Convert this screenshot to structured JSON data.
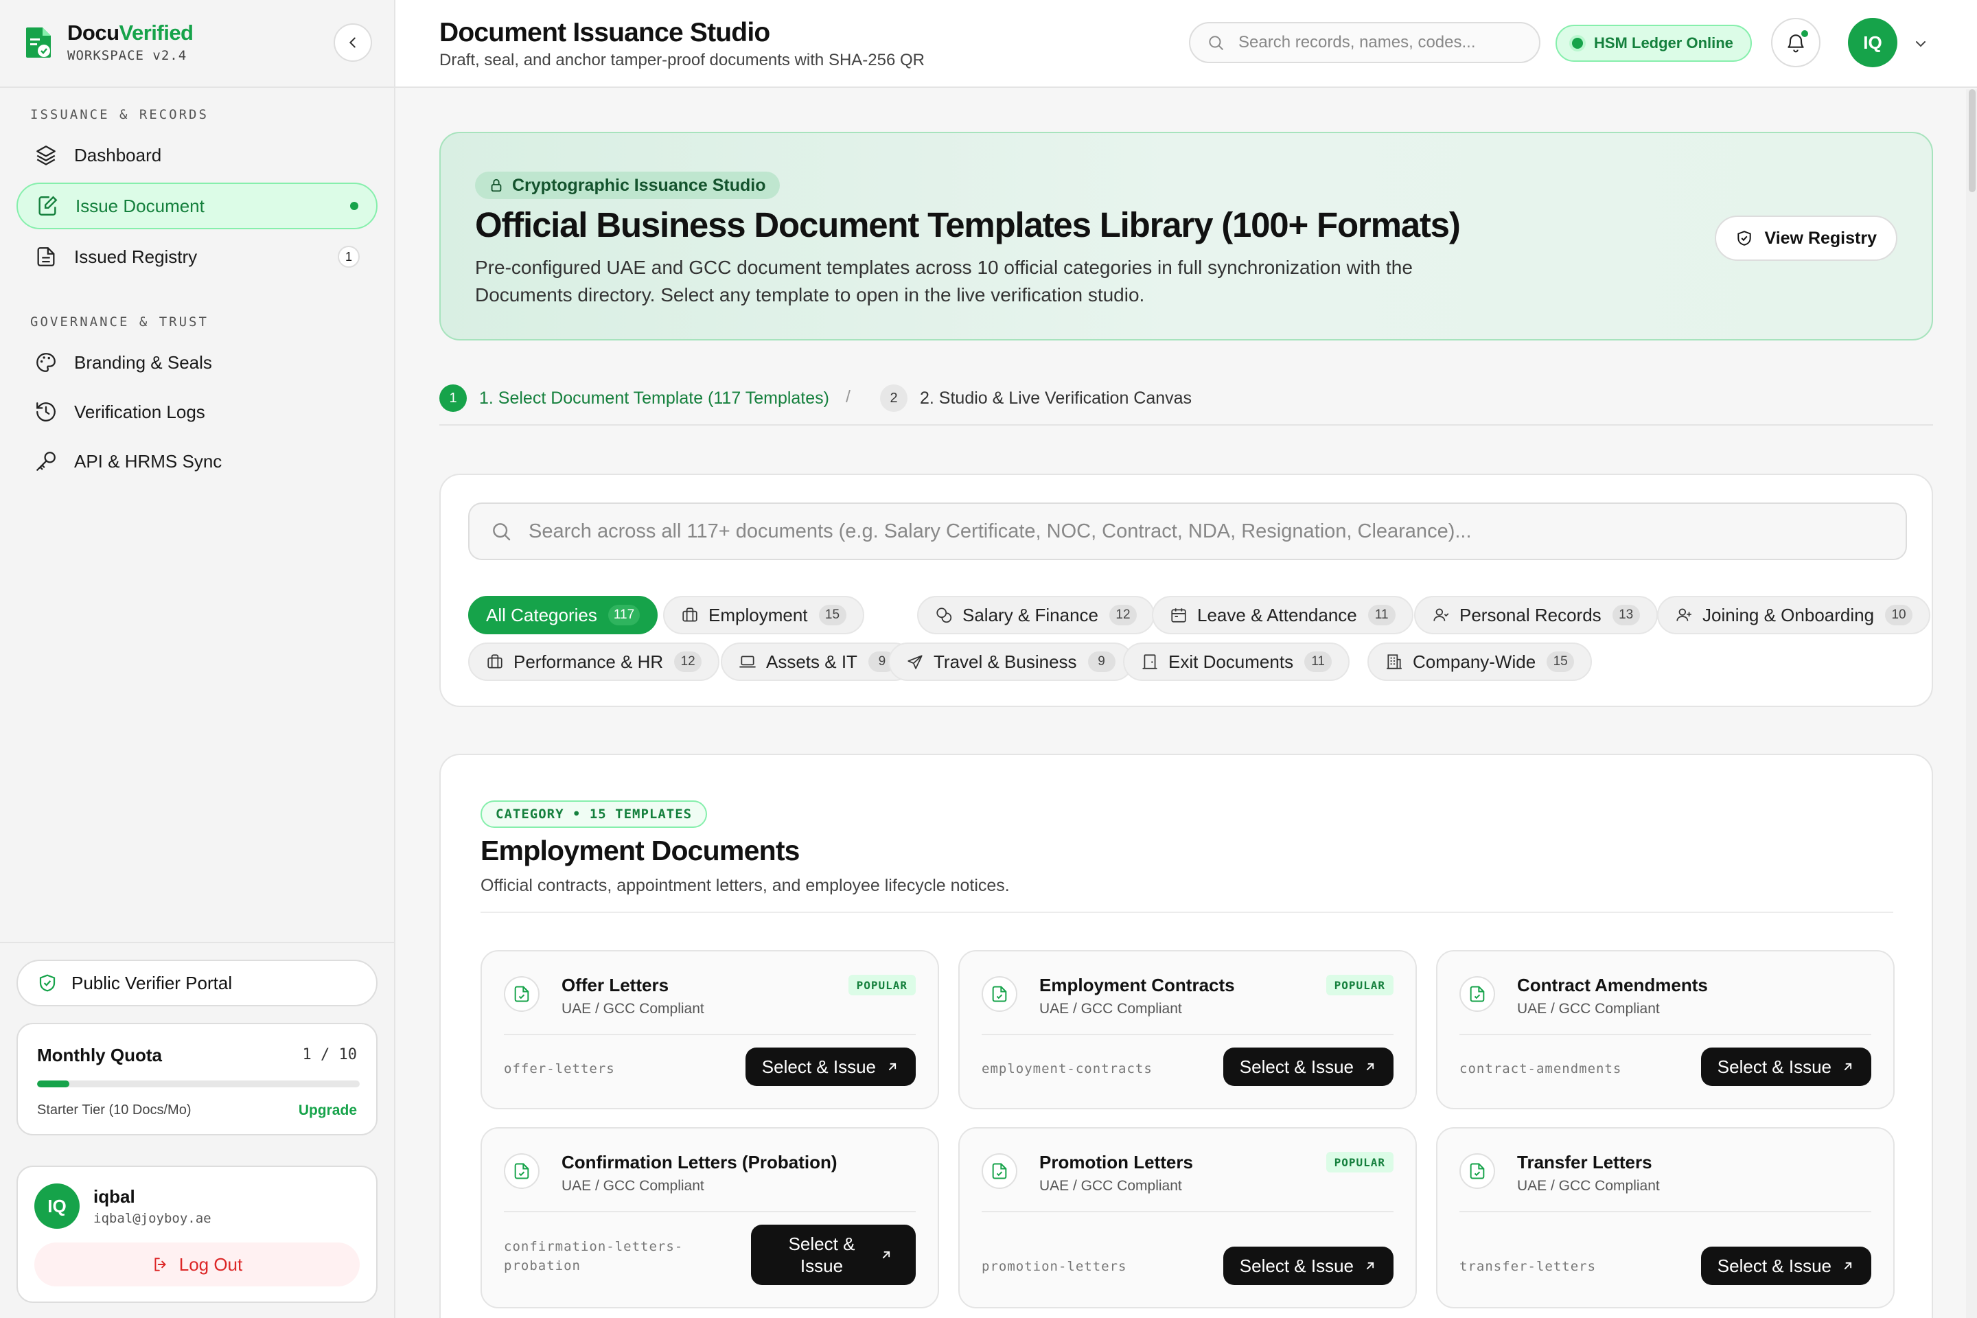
{
  "brand": {
    "name_prefix": "Docu",
    "name_accent": "Verified",
    "version": "WORKSPACE v2.4"
  },
  "colors": {
    "accent": "#16a34a",
    "accent_light": "#dcfce7",
    "danger": "#dc2626",
    "dark": "#111111"
  },
  "sidebar": {
    "section_issuance": "ISSUANCE & RECORDS",
    "section_governance": "GOVERNANCE & TRUST",
    "items": [
      {
        "label": "Dashboard",
        "icon": "layers-icon"
      },
      {
        "label": "Issue Document",
        "icon": "document-edit-icon",
        "active": true
      },
      {
        "label": "Issued Registry",
        "icon": "document-list-icon",
        "badge": "1"
      },
      {
        "label": "Branding & Seals",
        "icon": "palette-icon"
      },
      {
        "label": "Verification Logs",
        "icon": "history-icon"
      },
      {
        "label": "API & HRMS Sync",
        "icon": "key-icon"
      }
    ],
    "verifier_portal": "Public Verifier Portal",
    "quota": {
      "title": "Monthly Quota",
      "count": "1 / 10",
      "used_fraction": 0.1,
      "tier": "Starter Tier (10 Docs/Mo)",
      "upgrade": "Upgrade"
    },
    "user": {
      "initials": "IQ",
      "name": "iqbal",
      "email": "iqbal@joyboy.ae",
      "logout": "Log Out"
    }
  },
  "header": {
    "title": "Document Issuance Studio",
    "subtitle": "Draft, seal, and anchor tamper-proof documents with SHA-256 QR",
    "search_placeholder": "Search records, names, codes...",
    "status": "HSM Ledger Online",
    "avatar_initials": "IQ"
  },
  "hero": {
    "pill": "Cryptographic Issuance Studio",
    "title": "Official Business Document Templates Library (100+ Formats)",
    "description": "Pre-configured UAE and GCC document templates across 10 official categories in full synchronization with the Documents directory. Select any template to open in the live verification studio.",
    "button": "View Registry"
  },
  "steps": [
    {
      "num": "1",
      "label": "1. Select Document Template (117 Templates)"
    },
    {
      "num": "2",
      "label": "2. Studio & Live Verification Canvas"
    }
  ],
  "step_separator": "/",
  "filters": {
    "search_placeholder": "Search across all 117+ documents (e.g. Salary Certificate, NOC, Contract, NDA, Resignation, Clearance)...",
    "chips": [
      {
        "label": "All Categories",
        "count": "117",
        "active": true
      },
      {
        "label": "Employment",
        "count": "15",
        "icon": "briefcase-icon"
      },
      {
        "label": "Salary & Finance",
        "count": "12",
        "icon": "coins-icon"
      },
      {
        "label": "Leave & Attendance",
        "count": "11",
        "icon": "calendar-icon"
      },
      {
        "label": "Personal Records",
        "count": "13",
        "icon": "user-icon"
      },
      {
        "label": "Joining & Onboarding",
        "count": "10",
        "icon": "user-plus-icon"
      },
      {
        "label": "Performance & HR",
        "count": "12",
        "icon": "briefcase-icon"
      },
      {
        "label": "Assets & IT",
        "count": "9",
        "icon": "laptop-icon"
      },
      {
        "label": "Travel & Business",
        "count": "9",
        "icon": "plane-icon"
      },
      {
        "label": "Exit Documents",
        "count": "11",
        "icon": "door-icon"
      },
      {
        "label": "Company-Wide",
        "count": "15",
        "icon": "building-icon"
      }
    ]
  },
  "category": {
    "tag": "CATEGORY • 15 TEMPLATES",
    "title": "Employment Documents",
    "description": "Official contracts, appointment letters, and employee lifecycle notices.",
    "cards": [
      {
        "title": "Offer Letters",
        "sub": "UAE / GCC Compliant",
        "popular": "POPULAR",
        "slug": "offer-letters",
        "button": "Select & Issue"
      },
      {
        "title": "Employment Contracts",
        "sub": "UAE / GCC Compliant",
        "popular": "POPULAR",
        "slug": "employment-contracts",
        "button": "Select & Issue"
      },
      {
        "title": "Contract Amendments",
        "sub": "UAE / GCC Compliant",
        "slug": "contract-amendments",
        "button": "Select & Issue"
      },
      {
        "title": "Confirmation Letters (Probation)",
        "sub": "UAE / GCC Compliant",
        "slug": "confirmation-letters-probation",
        "button": "Select & Issue"
      },
      {
        "title": "Promotion Letters",
        "sub": "UAE / GCC Compliant",
        "popular": "POPULAR",
        "slug": "promotion-letters",
        "button": "Select & Issue"
      },
      {
        "title": "Transfer Letters",
        "sub": "UAE / GCC Compliant",
        "slug": "transfer-letters",
        "button": "Select & Issue"
      }
    ]
  }
}
